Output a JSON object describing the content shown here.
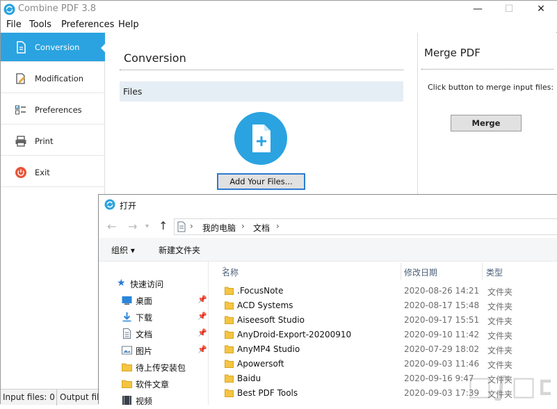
{
  "app": {
    "title": "Combine PDF 3.8",
    "window_buttons": {
      "minimize": "—",
      "maximize": "☐",
      "close": "✕"
    }
  },
  "menu": [
    "File",
    "Tools",
    "Preferences",
    "Help"
  ],
  "sidebar": {
    "accent": "#2aa3e0",
    "items": [
      {
        "label": "Conversion",
        "icon": "document-convert-icon",
        "active": true
      },
      {
        "label": "Modification",
        "icon": "edit-document-icon",
        "active": false
      },
      {
        "label": "Preferences",
        "icon": "checklist-icon",
        "active": false
      },
      {
        "label": "Print",
        "icon": "printer-icon",
        "active": false
      },
      {
        "label": "Exit",
        "icon": "power-icon",
        "active": false
      }
    ]
  },
  "conversion": {
    "title": "Conversion",
    "files_label": "Files",
    "add_button": "Add Your Files..."
  },
  "merge": {
    "title": "Merge PDF",
    "hint": "Click button to merge input files:",
    "button": "Merge"
  },
  "status": {
    "input_files": "Input files: 0",
    "output_file": "Output file"
  },
  "dialog": {
    "title": "打开",
    "breadcrumb": [
      "我的电脑",
      "文档"
    ],
    "toolbar": {
      "organize": "组织 ▾",
      "new_folder": "新建文件夹"
    },
    "nav_items": [
      {
        "label": "快速访问",
        "icon": "star-icon",
        "pinned": false
      },
      {
        "label": "桌面",
        "icon": "desktop-icon",
        "pinned": true
      },
      {
        "label": "下载",
        "icon": "download-icon",
        "pinned": true
      },
      {
        "label": "文档",
        "icon": "documents-icon",
        "pinned": true
      },
      {
        "label": "图片",
        "icon": "pictures-icon",
        "pinned": true
      },
      {
        "label": "待上传安装包",
        "icon": "folder-icon",
        "pinned": false
      },
      {
        "label": "软件文章",
        "icon": "folder-icon",
        "pinned": false
      },
      {
        "label": "视频",
        "icon": "video-icon",
        "pinned": false
      }
    ],
    "columns": {
      "name": "名称",
      "date": "修改日期",
      "type": "类型"
    },
    "rows": [
      {
        "name": ".FocusNote",
        "date": "2020-08-26 14:21",
        "type": "文件夹"
      },
      {
        "name": "ACD Systems",
        "date": "2020-08-17 15:48",
        "type": "文件夹"
      },
      {
        "name": "Aiseesoft Studio",
        "date": "2020-09-17 15:51",
        "type": "文件夹"
      },
      {
        "name": "AnyDroid-Export-20200910",
        "date": "2020-09-10 11:42",
        "type": "文件夹"
      },
      {
        "name": "AnyMP4 Studio",
        "date": "2020-07-29 18:02",
        "type": "文件夹"
      },
      {
        "name": "Apowersoft",
        "date": "2020-09-03 11:46",
        "type": "文件夹"
      },
      {
        "name": "Baidu",
        "date": "2020-09-16 9:47",
        "type": "文件夹"
      },
      {
        "name": "Best PDF Tools",
        "date": "2020-09-03 17:39",
        "type": "文件夹"
      }
    ]
  },
  "watermark": "IE"
}
